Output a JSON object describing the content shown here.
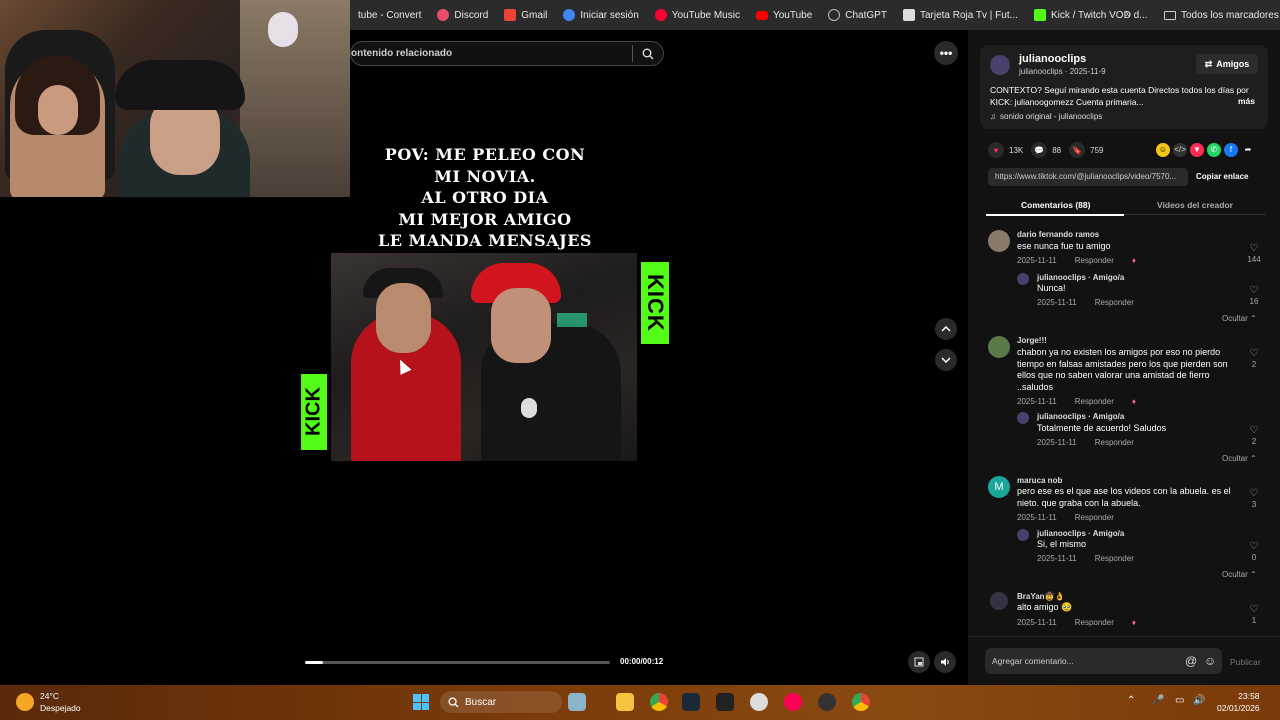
{
  "bookmarks": [
    {
      "label": "tube - Convert",
      "icon": "youtube-convert-icon",
      "color": "#2b2b2b"
    },
    {
      "label": "Discord",
      "icon": "discord-icon",
      "color": "#e84c6a"
    },
    {
      "label": "Gmail",
      "icon": "gmail-icon",
      "color": "#ea4335"
    },
    {
      "label": "Iniciar sesión",
      "icon": "login-icon",
      "color": "#4285f4"
    },
    {
      "label": "YouTube Music",
      "icon": "youtube-music-icon",
      "color": "#ff0000"
    },
    {
      "label": "YouTube",
      "icon": "youtube-icon",
      "color": "#ff0000"
    },
    {
      "label": "ChatGPT",
      "icon": "chatgpt-icon",
      "color": "#aaaaaa"
    },
    {
      "label": "Tarjeta Roja Tv | Fut...",
      "icon": "tarjeta-roja-icon",
      "color": "#dddddd"
    },
    {
      "label": "Kick / Twitch VOD d...",
      "icon": "kick-icon",
      "color": "#53fc18"
    }
  ],
  "bookmarks_more": "»",
  "bookmarks_all": "Todos los marcadores",
  "related_search": {
    "placeholder": "ontenido relacionado"
  },
  "video": {
    "caption_lines": [
      "POV: ME PELEO CON",
      "MI NOVIA.",
      "AL OTRO DIA",
      "MI MEJOR AMIGO",
      "LE MANDA MENSAJES"
    ],
    "kick_label": "KICK",
    "time": "00:00/00:12",
    "progress": 0.06
  },
  "author": {
    "name": "julianooclips",
    "sub": "julianooclips · 2025-11-9",
    "friends_button": "Amigos",
    "description": "CONTEXTO? Seguí mirando esta cuenta Directos todos los días por KICK: julianoogomezz Cuenta primaria...",
    "more": "más",
    "sound": "sonido original - julianooclips"
  },
  "stats": {
    "likes": "13K",
    "comments": "88",
    "saves": "759"
  },
  "link": {
    "url": "https://www.tiktok.com/@julianooclips/video/7570...",
    "copy": "Copiar enlace"
  },
  "tabs": {
    "comments": "Comentarios (88)",
    "creator": "Videos del creador"
  },
  "comments": [
    {
      "name": "dario fernando ramos",
      "text": "ese nunca fue tu amigo",
      "date": "2025-11-11",
      "reply": "Responder",
      "likes": "144",
      "sub": {
        "name": "julianooclips · Amigo/a",
        "text": "Nunca!",
        "date": "2025-11-11",
        "reply": "Responder",
        "likes": "16"
      },
      "hide": "Ocultar ⌃"
    },
    {
      "name": "Jorge!!!",
      "text": "chabon ya no existen los amigos por eso no pierdo tiempo en falsas amistades pero los que pierden son ellos que no saben valorar una amistad de fierro ..saludos",
      "date": "2025-11-11",
      "reply": "Responder",
      "likes": "2",
      "sub": {
        "name": "julianooclips · Amigo/a",
        "text": "Totalmente de acuerdo! Saludos",
        "date": "2025-11-11",
        "reply": "Responder",
        "likes": "2"
      },
      "hide": "Ocultar ⌃"
    },
    {
      "name": "maruca nob",
      "text": "pero ese es el que ase los videos con la abuela. es el nieto. que graba con la abuela.",
      "date": "2025-11-11",
      "reply": "Responder",
      "likes": "3",
      "sub": {
        "name": "julianooclips · Amigo/a",
        "text": "Si, el mismo",
        "date": "2025-11-11",
        "reply": "Responder",
        "likes": "0"
      },
      "hide": "Ocultar ⌃"
    },
    {
      "name": "BraYan🤠👌",
      "text": "alto amigo 🥹",
      "date": "2025-11-11",
      "reply": "Responder",
      "likes": "1"
    }
  ],
  "comment_input": {
    "placeholder": "Agregar comentario...",
    "publish": "Publicar"
  },
  "taskbar": {
    "temp": "24°C",
    "weather": "Despejado",
    "search": "Buscar",
    "time": "23:58",
    "date": "02/01/2026"
  },
  "colors": {
    "accent_like": "#fe2c55",
    "kick_green": "#53fc18",
    "panel_bg": "#121212"
  }
}
